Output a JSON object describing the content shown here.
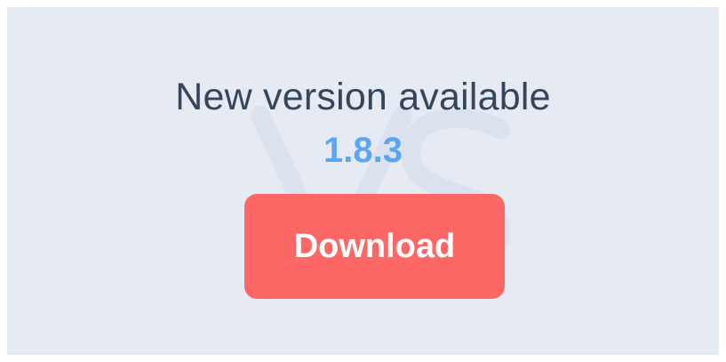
{
  "dialog": {
    "title": "New version available",
    "version": "1.8.3",
    "download_label": "Download"
  },
  "icons": {
    "watermark": "app-logo-watermark-icon"
  },
  "colors": {
    "background": "#e6ebf3",
    "title": "#35465c",
    "version": "#5aa6f4",
    "button": "#fd6867",
    "button_text": "#ffffff"
  }
}
